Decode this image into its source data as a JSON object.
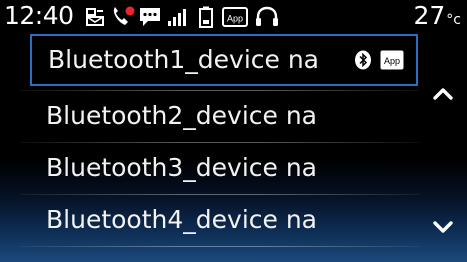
{
  "status_bar": {
    "time": "12:40",
    "temperature": "27",
    "temperature_unit": "°c",
    "icons": [
      "sms-icon",
      "phone-missed-call-icon",
      "message-icon",
      "signal-strength-icon",
      "battery-icon",
      "app-icon",
      "headset-icon"
    ],
    "app_icon_text": "App"
  },
  "device_list": {
    "items": [
      {
        "label": "Bluetooth1_device na",
        "selected": true,
        "icons": [
          "bluetooth-icon",
          "app-icon"
        ],
        "app_icon_text": "App"
      },
      {
        "label": "Bluetooth2_device na",
        "selected": false
      },
      {
        "label": "Bluetooth3_device na",
        "selected": false
      },
      {
        "label": "Bluetooth4_device na",
        "selected": false
      }
    ]
  },
  "scroll": {
    "up_icon": "chevron-up-icon",
    "down_icon": "chevron-down-icon"
  },
  "colors": {
    "selection_border": "#2c6cc4",
    "highlight_missed_call": "#e8262b",
    "background": "#000000",
    "bottom_gradient": "#1b4a7c"
  }
}
